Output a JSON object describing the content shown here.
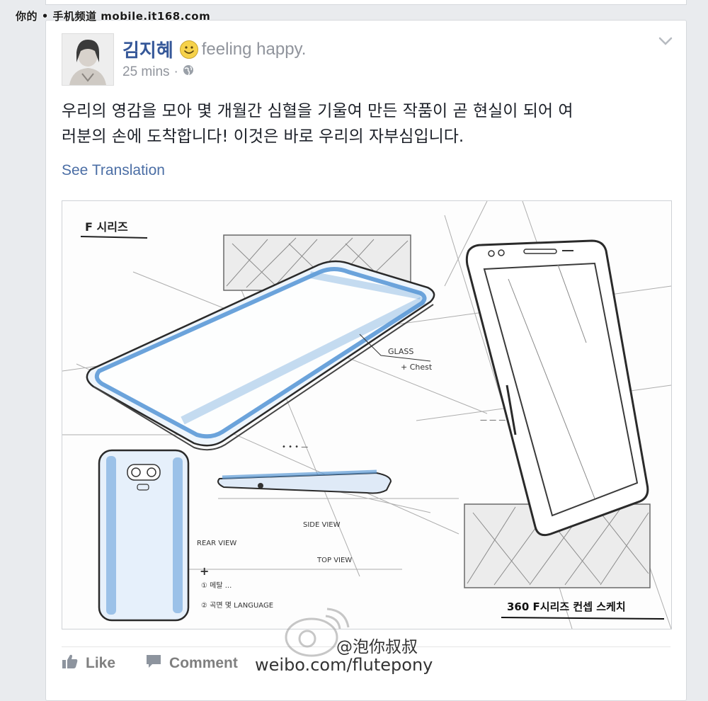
{
  "watermark": {
    "top_text": "你的 • 手机频道 mobile.it168.com"
  },
  "post": {
    "author": "김지혜",
    "feeling": "feeling happy.",
    "time": "25 mins",
    "meta_separator": "·",
    "privacy_icon": "globe-icon",
    "body_line1": "우리의 영감을 모아 몇 개월간 심혈을 기울여 만든 작품이 곧 현실이 되어 여",
    "body_line2": "러분의 손에 도착합니다! 이것은 바로 우리의 자부심입니다.",
    "see_translation": "See Translation",
    "menu_icon": "chevron-down-icon",
    "feeling_icon": "smiley-icon"
  },
  "sketch": {
    "title_label": "F 시리즈",
    "glass_note_1": "GLASS",
    "glass_note_2": "+ Chest",
    "bottom_label": "360 F시리즈 컨셉 스케치",
    "rear_note_1": "① 메탈 ...",
    "rear_note_2": "② 곡면 몇 LANGUAGE",
    "side_view_label": "SIDE VIEW",
    "rear_view_label": "REAR VIEW",
    "top_view_label": "TOP VIEW"
  },
  "actions": {
    "like": "Like",
    "comment": "Comment",
    "like_icon": "thumbs-up-icon",
    "comment_icon": "speech-bubble-icon"
  },
  "weibo": {
    "handle": "@泡你叔叔",
    "url": "weibo.com/flutepony"
  },
  "colors": {
    "link": "#365899",
    "translation_link": "#4b6ea5",
    "meta_gray": "#90949c",
    "sketch_blue": "#5d9bd8"
  }
}
